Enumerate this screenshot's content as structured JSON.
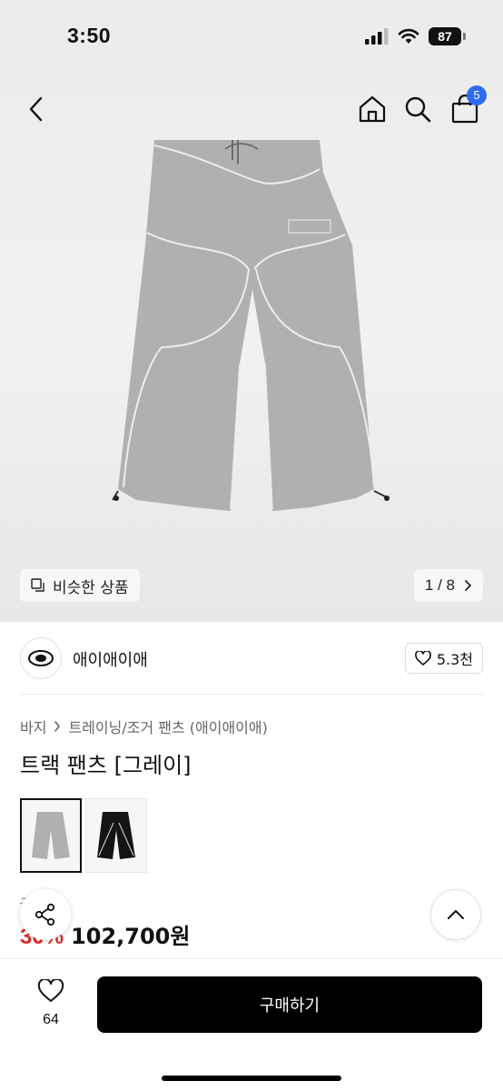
{
  "status_bar": {
    "time": "3:50",
    "battery": "87"
  },
  "nav": {
    "cart_count": "5"
  },
  "gallery": {
    "similar_label": "비슷한 상품",
    "counter": "1 / 8"
  },
  "brand": {
    "name": "애이애이애",
    "likes": "5.3천"
  },
  "breadcrumb": {
    "category": "바지",
    "subcategory": "트레이닝/조거 팬츠 (애이애이애)"
  },
  "product": {
    "title": "트랙 팬츠 [그레이]",
    "original_price": "3   0원",
    "discount": "30%",
    "sale_price": "102,700원",
    "color_options": [
      "그레이",
      "블랙"
    ]
  },
  "bottom_bar": {
    "wish_count": "64",
    "buy_label": "구매하기"
  },
  "colors": {
    "accent": "#2f6bf0",
    "discount": "#e02b2b",
    "buy_button": "#000000",
    "pants_gray": "#b1afb1"
  },
  "icons": [
    "back-icon",
    "home-icon",
    "search-icon",
    "shopping-bag-icon",
    "similar-icon",
    "chevron-right-icon",
    "heart-icon",
    "share-icon",
    "chevron-up-icon"
  ]
}
